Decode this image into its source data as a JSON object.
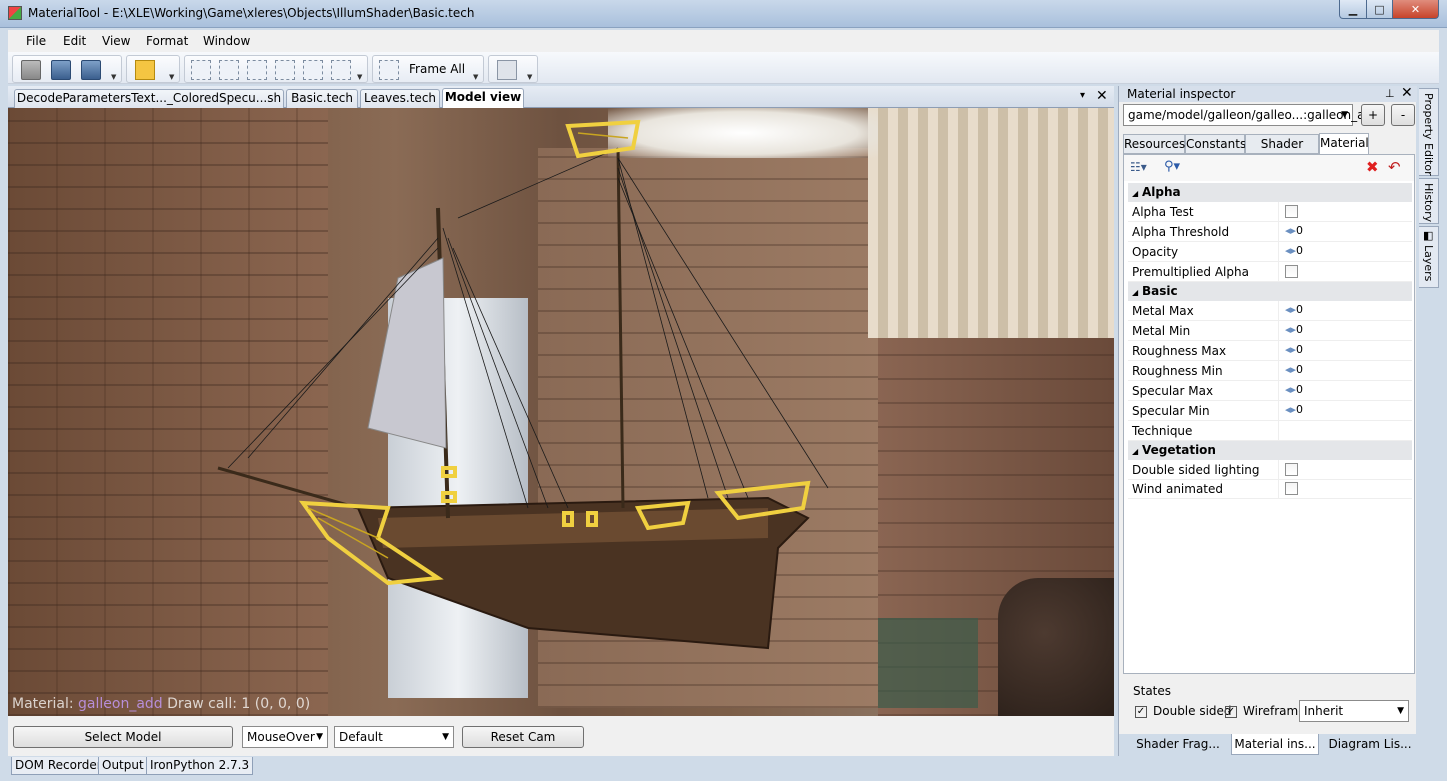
{
  "window": {
    "title": "MaterialTool - E:\\XLE\\Working\\Game\\xleres\\Objects\\IllumShader\\Basic.tech",
    "min_label": "▁",
    "max_label": "□",
    "close_label": "✕"
  },
  "menu": {
    "items": [
      "File",
      "Edit",
      "View",
      "Format",
      "Window"
    ]
  },
  "toolbar": {
    "frame_all_label": "Frame All"
  },
  "doc_tabs": {
    "tabs": [
      "DecodeParametersText..._ColoredSpecu...sh",
      "Basic.tech",
      "Leaves.tech",
      "Model view"
    ],
    "active_index": 3,
    "dropdown_label": "▾",
    "close_label": "✕"
  },
  "viewport": {
    "overlay_prefix": "Material:",
    "overlay_material": "galleon_add",
    "overlay_suffix": "Draw call: 1 (0, 0, 0)"
  },
  "vp_controls": {
    "select_model_label": "Select Model",
    "mouseover_value": "MouseOver",
    "default_value": "Default",
    "reset_cam_label": "Reset Cam"
  },
  "bottom_tabs": [
    "DOM Recorder",
    "Output",
    "IronPython 2.7.3"
  ],
  "inspector": {
    "title": "Material inspector",
    "pin_label": "📌",
    "close_label": "✕",
    "material_combo": "game/model/galleon/galleo...:galleon_add",
    "add_label": "+",
    "remove_label": "-",
    "tabs": [
      "Resources",
      "Constants",
      "Shader Flags",
      "Material"
    ],
    "active_tab": 3,
    "categories": [
      {
        "name": "Alpha",
        "rows": [
          {
            "label": "Alpha Test",
            "type": "checkbox",
            "value": false
          },
          {
            "label": "Alpha Threshold",
            "type": "slider",
            "value": "0"
          },
          {
            "label": "Opacity",
            "type": "slider",
            "value": "0"
          },
          {
            "label": "Premultiplied Alpha",
            "type": "checkbox",
            "value": false
          }
        ]
      },
      {
        "name": "Basic",
        "rows": [
          {
            "label": "Metal Max",
            "type": "slider",
            "value": "0"
          },
          {
            "label": "Metal Min",
            "type": "slider",
            "value": "0"
          },
          {
            "label": "Roughness Max",
            "type": "slider",
            "value": "0"
          },
          {
            "label": "Roughness Min",
            "type": "slider",
            "value": "0"
          },
          {
            "label": "Specular Max",
            "type": "slider",
            "value": "0"
          },
          {
            "label": "Specular Min",
            "type": "slider",
            "value": "0"
          },
          {
            "label": "Technique",
            "type": "text",
            "value": ""
          }
        ]
      },
      {
        "name": "Vegetation",
        "rows": [
          {
            "label": "Double sided lighting",
            "type": "checkbox",
            "value": false
          },
          {
            "label": "Wind animated",
            "type": "checkbox",
            "value": false
          }
        ]
      }
    ],
    "states": {
      "title": "States",
      "double_sided_label": "Double sided",
      "wireframe_label": "Wireframe",
      "inherit_value": "Inherit"
    },
    "dock_tabs": [
      "Shader Frag...",
      "Material ins...",
      "Diagram Lis..."
    ],
    "dock_active": 1
  },
  "side_tabs": [
    "Property Editor",
    "History",
    "Layers"
  ],
  "colors": {
    "highlight": "#f0d040",
    "material_name": "#b78ed8"
  }
}
